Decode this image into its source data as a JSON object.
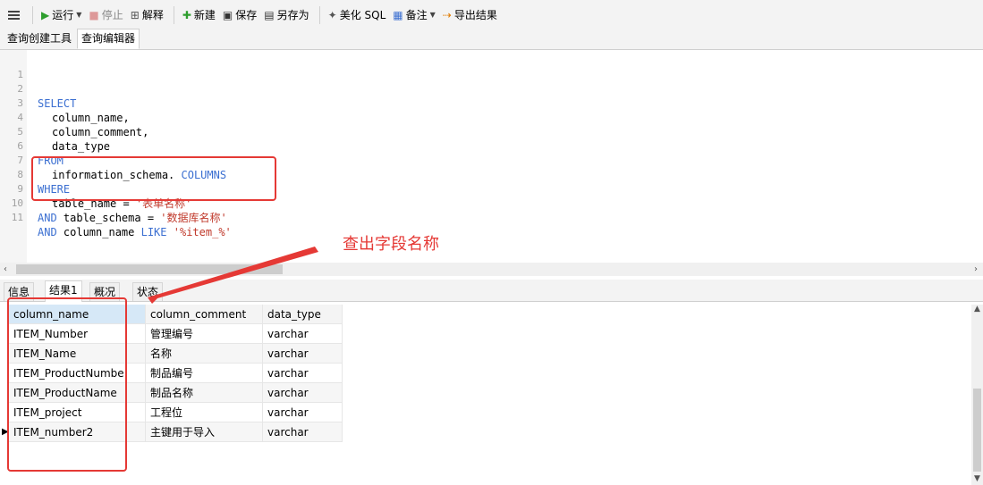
{
  "toolbar": {
    "run": "运行",
    "stop": "停止",
    "explain": "解释",
    "new": "新建",
    "save": "保存",
    "save_as": "另存为",
    "beautify": "美化 SQL",
    "comment": "备注",
    "export": "导出结果"
  },
  "tabs": [
    "查询创建工具",
    "查询编辑器"
  ],
  "editor": {
    "lines": [
      {
        "n": "1"
      },
      {
        "n": "2"
      },
      {
        "n": "3"
      },
      {
        "n": "4"
      },
      {
        "n": "5"
      },
      {
        "n": "6"
      },
      {
        "n": "7"
      },
      {
        "n": "8"
      },
      {
        "n": "9"
      },
      {
        "n": "10"
      },
      {
        "n": "11"
      }
    ],
    "select_kw": "SELECT",
    "col1": "column_name,",
    "col2": "column_comment,",
    "col3": "data_type",
    "from_kw": "FROM",
    "schema_ref": "information_schema. ",
    "columns_kw": "COLUMNS",
    "where_kw": "WHERE",
    "tn_expr": "table_name = ",
    "tn_value": "'表单名称'",
    "and_kw": "AND",
    "ts_expr": " table_schema = ",
    "ts_value": "'数据库名称'",
    "cn_expr": " column_name ",
    "like_kw": "LIKE",
    "cn_value": " '%item_%'"
  },
  "annotation": {
    "text": "查出字段名称",
    "color": "#e53935"
  },
  "result_tabs": [
    "信息",
    "结果1",
    "概况",
    "状态"
  ],
  "grid": {
    "columns": [
      "column_name",
      "column_comment",
      "data_type"
    ],
    "rows": [
      [
        "ITEM_Number",
        "管理编号",
        "varchar"
      ],
      [
        "ITEM_Name",
        "名称",
        "varchar"
      ],
      [
        "ITEM_ProductNumbe",
        "制品编号",
        "varchar"
      ],
      [
        "ITEM_ProductName",
        "制品名称",
        "varchar"
      ],
      [
        "ITEM_project",
        "工程位",
        "varchar"
      ],
      [
        "ITEM_number2",
        "主键用于导入",
        "varchar"
      ]
    ]
  }
}
